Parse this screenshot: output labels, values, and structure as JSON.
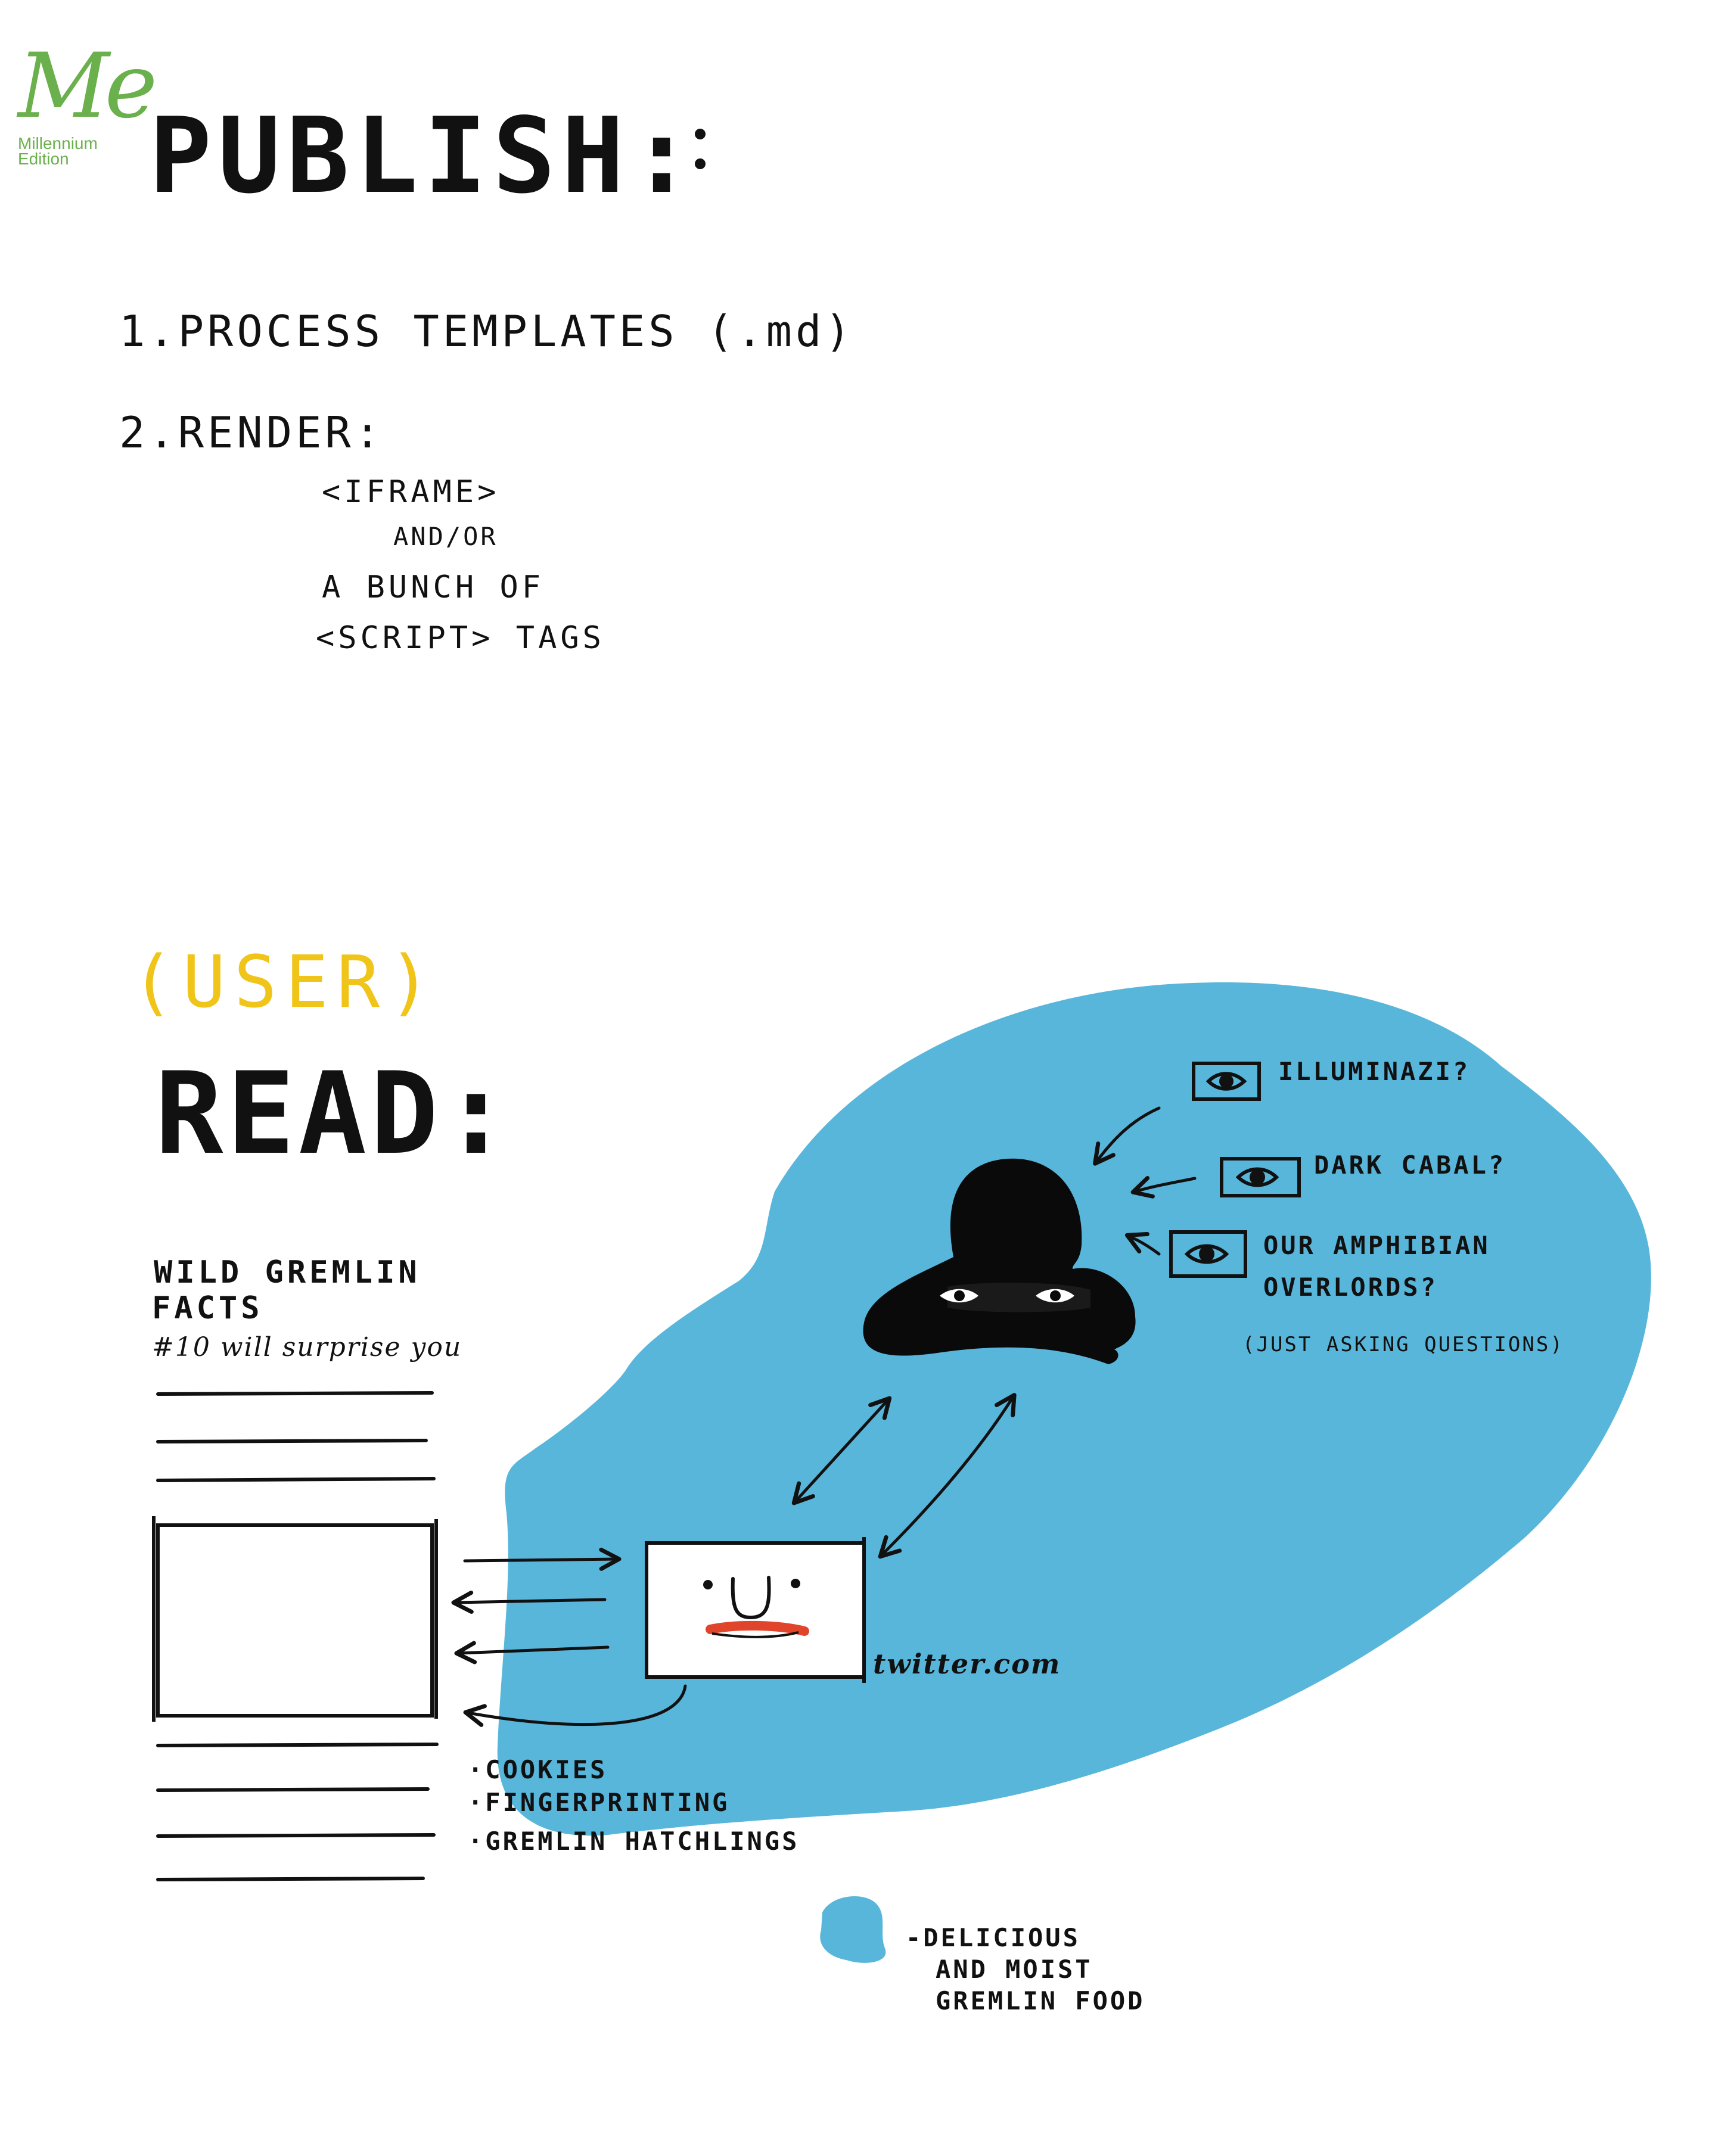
{
  "logo": {
    "mark": "Me",
    "subtitle": "Millennium\nEdition",
    "color": "#6ab04c"
  },
  "publish": {
    "heading": "PUBLISH:",
    "step1": "1.PROCESS TEMPLATES (.md)",
    "step2": "2.RENDER:",
    "render_items": [
      "<IFRAME>",
      "AND/OR",
      "A BUNCH OF",
      "<SCRIPT> TAGS"
    ]
  },
  "read": {
    "user_label": "(USER)",
    "heading": "READ:",
    "article": {
      "title_line1": "WILD GREMLIN",
      "title_line2": "FACTS",
      "subtitle": "#10 will surprise you"
    },
    "tracking": [
      "·COOKIES",
      "·FINGERPRINTING",
      "·GREMLIN HATCHLINGS"
    ],
    "embed_label": "twitter.com",
    "suspects": [
      "ILLUMINAZI?",
      "DARK CABAL?",
      "OUR AMPHIBIAN",
      "OVERLORDS?"
    ],
    "aside": "(JUST ASKING QUESTIONS)",
    "legend": [
      "-DELICIOUS",
      "AND MOIST",
      "GREMLIN FOOD"
    ]
  },
  "colors": {
    "blob": "#58b6db",
    "user": "#f0c419",
    "ink": "#111111",
    "mouth": "#e0452b"
  }
}
